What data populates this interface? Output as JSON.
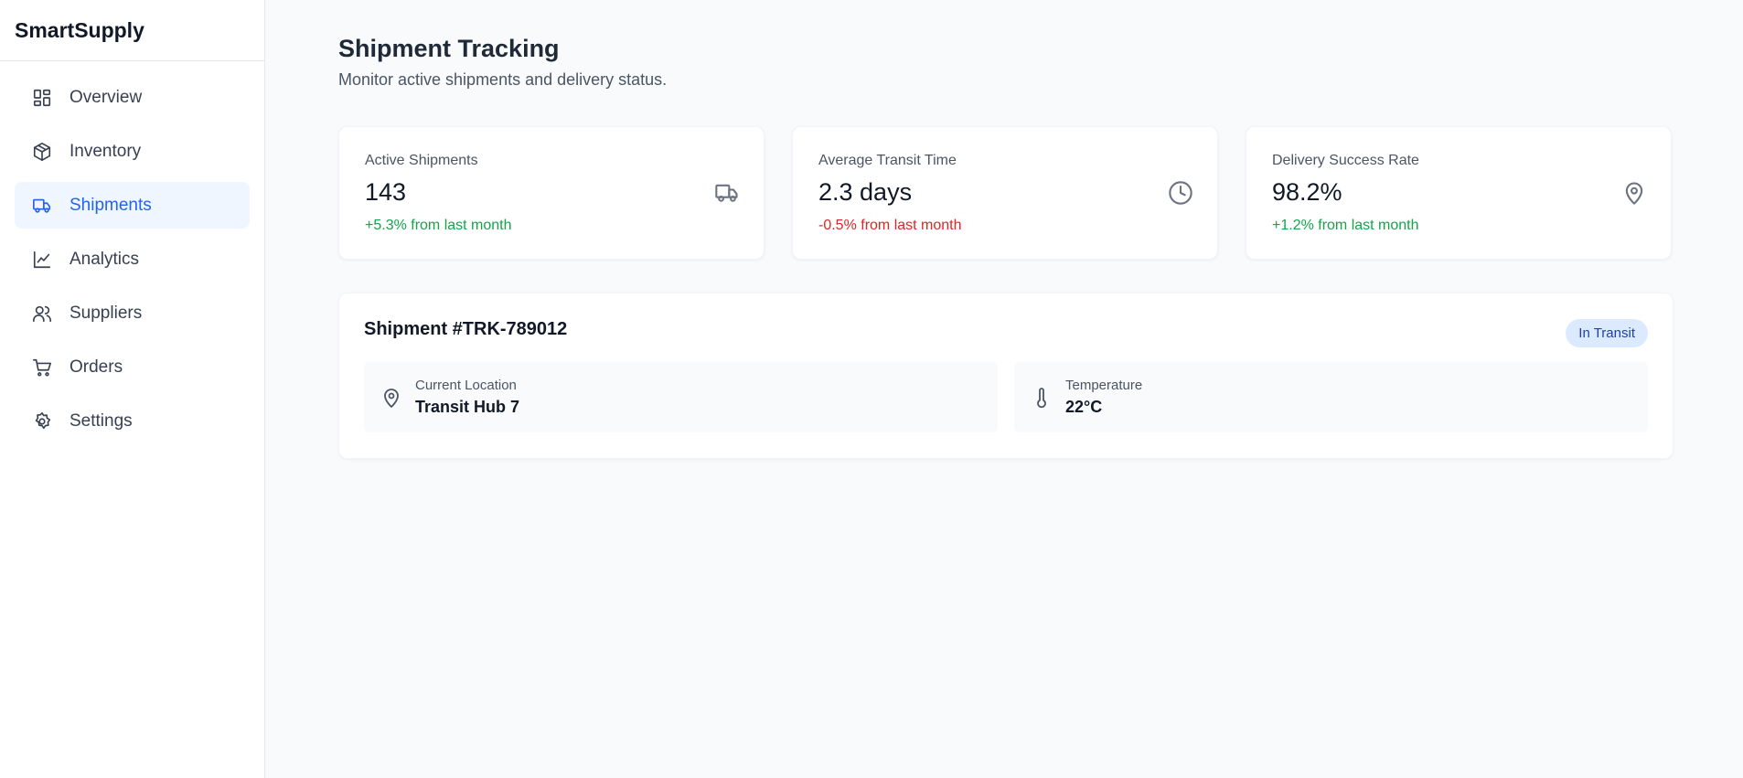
{
  "app": {
    "name": "SmartSupply"
  },
  "sidebar": {
    "items": [
      {
        "label": "Overview",
        "icon": "grid-icon"
      },
      {
        "label": "Inventory",
        "icon": "box-icon"
      },
      {
        "label": "Shipments",
        "icon": "truck-icon",
        "active": true
      },
      {
        "label": "Analytics",
        "icon": "chart-line-icon"
      },
      {
        "label": "Suppliers",
        "icon": "users-icon"
      },
      {
        "label": "Orders",
        "icon": "cart-icon"
      },
      {
        "label": "Settings",
        "icon": "gear-icon"
      }
    ]
  },
  "header": {
    "title": "Shipment Tracking",
    "subtitle": "Monitor active shipments and delivery status."
  },
  "stats": [
    {
      "label": "Active Shipments",
      "value": "143",
      "change": "+5.3% from last month",
      "trend": "up",
      "icon": "truck-icon"
    },
    {
      "label": "Average Transit Time",
      "value": "2.3 days",
      "change": "-0.5% from last month",
      "trend": "down",
      "icon": "clock-icon"
    },
    {
      "label": "Delivery Success Rate",
      "value": "98.2%",
      "change": "+1.2% from last month",
      "trend": "up",
      "icon": "map-pin-icon"
    }
  ],
  "shipment": {
    "title": "Shipment #TRK-789012",
    "status": "In Transit",
    "location_label": "Current Location",
    "location_value": "Transit Hub 7",
    "temperature_label": "Temperature",
    "temperature_value": "22°C"
  },
  "colors": {
    "accent": "#2563eb",
    "active_bg": "#eff6ff",
    "positive": "#16a34a",
    "negative": "#dc2626",
    "badge_bg": "#dbeafe"
  }
}
